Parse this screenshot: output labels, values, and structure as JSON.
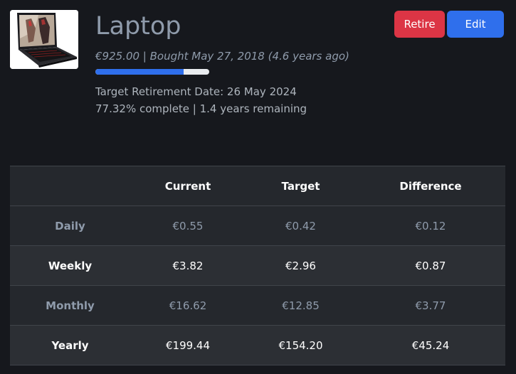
{
  "item": {
    "image_icon": "laptop-photo",
    "title": "Laptop",
    "subtitle": "€925.00 | Bought May 27, 2018 (4.6 years ago)",
    "progress_fraction": 0.7732,
    "target_retirement": "Target Retirement Date: 26 May 2024",
    "completion": "77.32% complete | 1.4 years remaining"
  },
  "actions": {
    "retire_label": "Retire",
    "edit_label": "Edit"
  },
  "colors": {
    "background": "#16181d",
    "accent_blue": "#2f6fec",
    "danger_red": "#dc3545",
    "muted_text": "#8f9bab"
  },
  "table": {
    "headers": [
      "",
      "Current",
      "Target",
      "Difference"
    ],
    "rows": [
      {
        "label": "Daily",
        "current": "€0.55",
        "target": "€0.42",
        "difference": "€0.12"
      },
      {
        "label": "Weekly",
        "current": "€3.82",
        "target": "€2.96",
        "difference": "€0.87"
      },
      {
        "label": "Monthly",
        "current": "€16.62",
        "target": "€12.85",
        "difference": "€3.77"
      },
      {
        "label": "Yearly",
        "current": "€199.44",
        "target": "€154.20",
        "difference": "€45.24"
      }
    ]
  }
}
